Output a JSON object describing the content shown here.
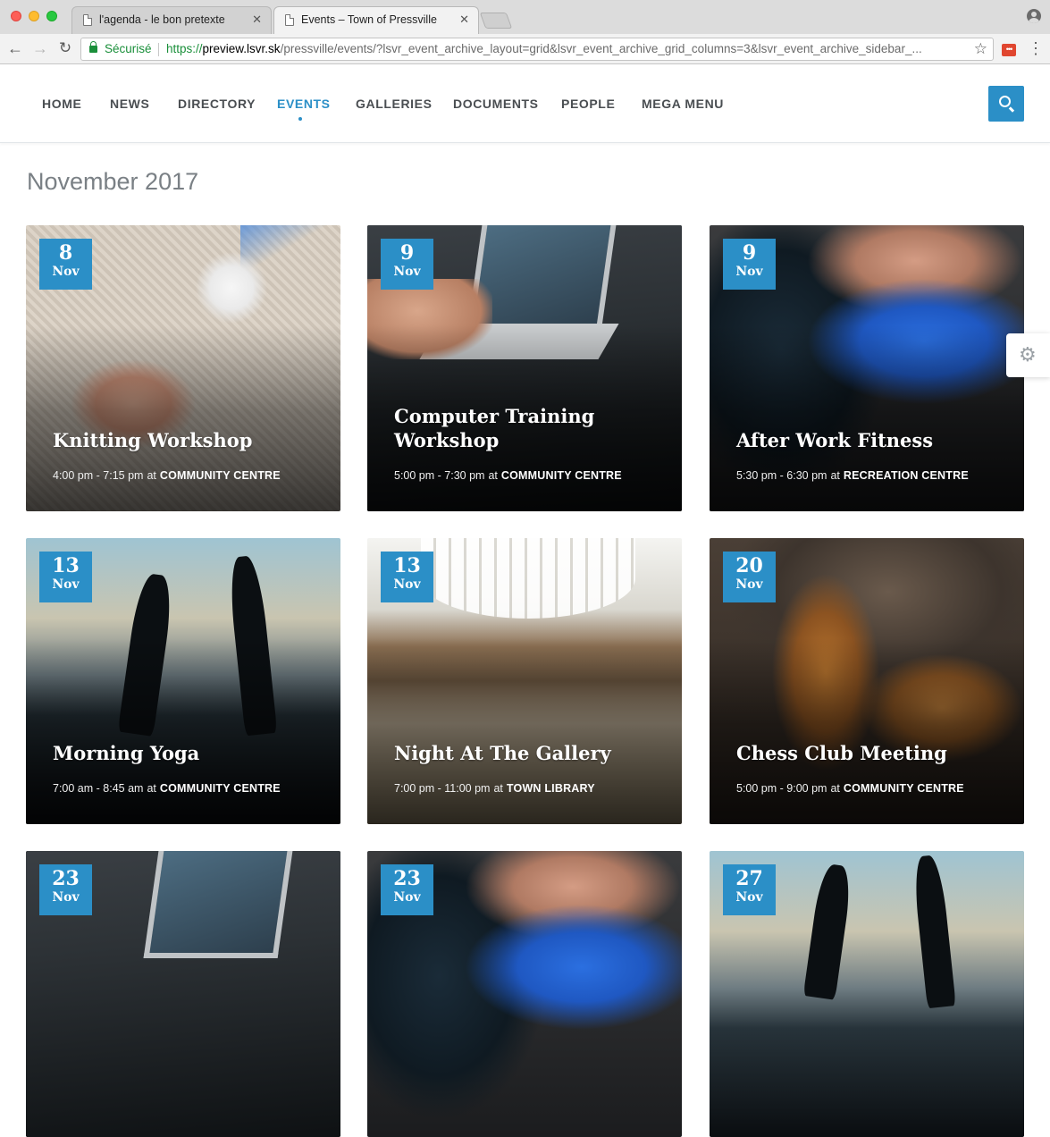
{
  "browser": {
    "tabs": [
      {
        "title": "l'agenda - le bon pretexte",
        "active": false
      },
      {
        "title": "Events – Town of Pressville",
        "active": true
      }
    ],
    "tab_close": "✕",
    "secure_label": "Sécurisé",
    "url_scheme": "https://",
    "url_host": "preview.lsvr.sk",
    "url_path": "/pressville/events/?lsvr_event_archive_layout=grid&lsvr_event_archive_grid_columns=3&lsvr_event_archive_sidebar_...",
    "icons": {
      "back": "←",
      "forward": "→",
      "reload": "↻",
      "star": "☆",
      "menu": "⋮",
      "extension": "•••"
    }
  },
  "site": {
    "nav": [
      {
        "label": "HOME",
        "active": false
      },
      {
        "label": "NEWS",
        "active": false
      },
      {
        "label": "DIRECTORY",
        "active": false
      },
      {
        "label": "EVENTS",
        "active": true
      },
      {
        "label": "GALLERIES",
        "active": false
      },
      {
        "label": "DOCUMENTS",
        "active": false
      },
      {
        "label": "PEOPLE",
        "active": false
      },
      {
        "label": "MEGA MENU",
        "active": false
      }
    ],
    "accent_color": "#2b8fc7",
    "search_icon": "search-icon",
    "settings_icon": "gear-icon"
  },
  "month_heading": "November 2017",
  "events": [
    {
      "day": "8",
      "month": "Nov",
      "title": "Knitting Workshop",
      "time": "4:00 pm - 7:15 pm",
      "at": "at",
      "venue": "COMMUNITY CENTRE"
    },
    {
      "day": "9",
      "month": "Nov",
      "title": "Computer Training Workshop",
      "time": "5:00 pm - 7:30 pm",
      "at": "at",
      "venue": "COMMUNITY CENTRE"
    },
    {
      "day": "9",
      "month": "Nov",
      "title": "After Work Fitness",
      "time": "5:30 pm - 6:30 pm",
      "at": "at",
      "venue": "RECREATION CENTRE"
    },
    {
      "day": "13",
      "month": "Nov",
      "title": "Morning Yoga",
      "time": "7:00 am - 8:45 am",
      "at": "at",
      "venue": "COMMUNITY CENTRE"
    },
    {
      "day": "13",
      "month": "Nov",
      "title": "Night At The Gallery",
      "time": "7:00 pm - 11:00 pm",
      "at": "at",
      "venue": "TOWN LIBRARY"
    },
    {
      "day": "20",
      "month": "Nov",
      "title": "Chess Club Meeting",
      "time": "5:00 pm - 9:00 pm",
      "at": "at",
      "venue": "COMMUNITY CENTRE"
    },
    {
      "day": "23",
      "month": "Nov"
    },
    {
      "day": "23",
      "month": "Nov"
    },
    {
      "day": "27",
      "month": "Nov"
    }
  ]
}
